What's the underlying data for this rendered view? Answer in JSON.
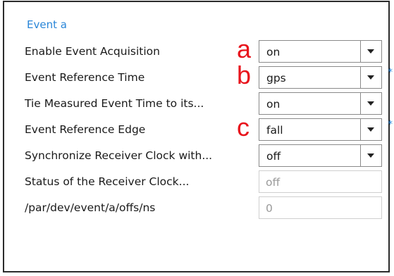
{
  "group": {
    "title": "Event a"
  },
  "rows": [
    {
      "label": "Enable Event Acquisition",
      "marker": "a",
      "value": "on",
      "modified": ""
    },
    {
      "label": "Event Reference Time",
      "marker": "b",
      "value": "gps",
      "modified": "*"
    },
    {
      "label": "Tie Measured Event Time to its...",
      "marker": "",
      "value": "on",
      "modified": ""
    },
    {
      "label": "Event Reference Edge",
      "marker": "c",
      "value": "fall",
      "modified": "*"
    },
    {
      "label": "Synchronize Receiver Clock with...",
      "marker": "",
      "value": "off",
      "modified": ""
    },
    {
      "label": "Status of the Receiver Clock...",
      "marker": "",
      "value": "off",
      "modified": ""
    },
    {
      "label": "/par/dev/event/a/offs/ns",
      "marker": "",
      "value": "0",
      "modified": ""
    }
  ],
  "colors": {
    "group_title": "#2a86d8",
    "marker": "#e8141c",
    "modified_marker": "#2a86d8",
    "readonly_text": "#9a9a9a"
  },
  "icons": {
    "dropdown": "chevron-down-icon"
  }
}
